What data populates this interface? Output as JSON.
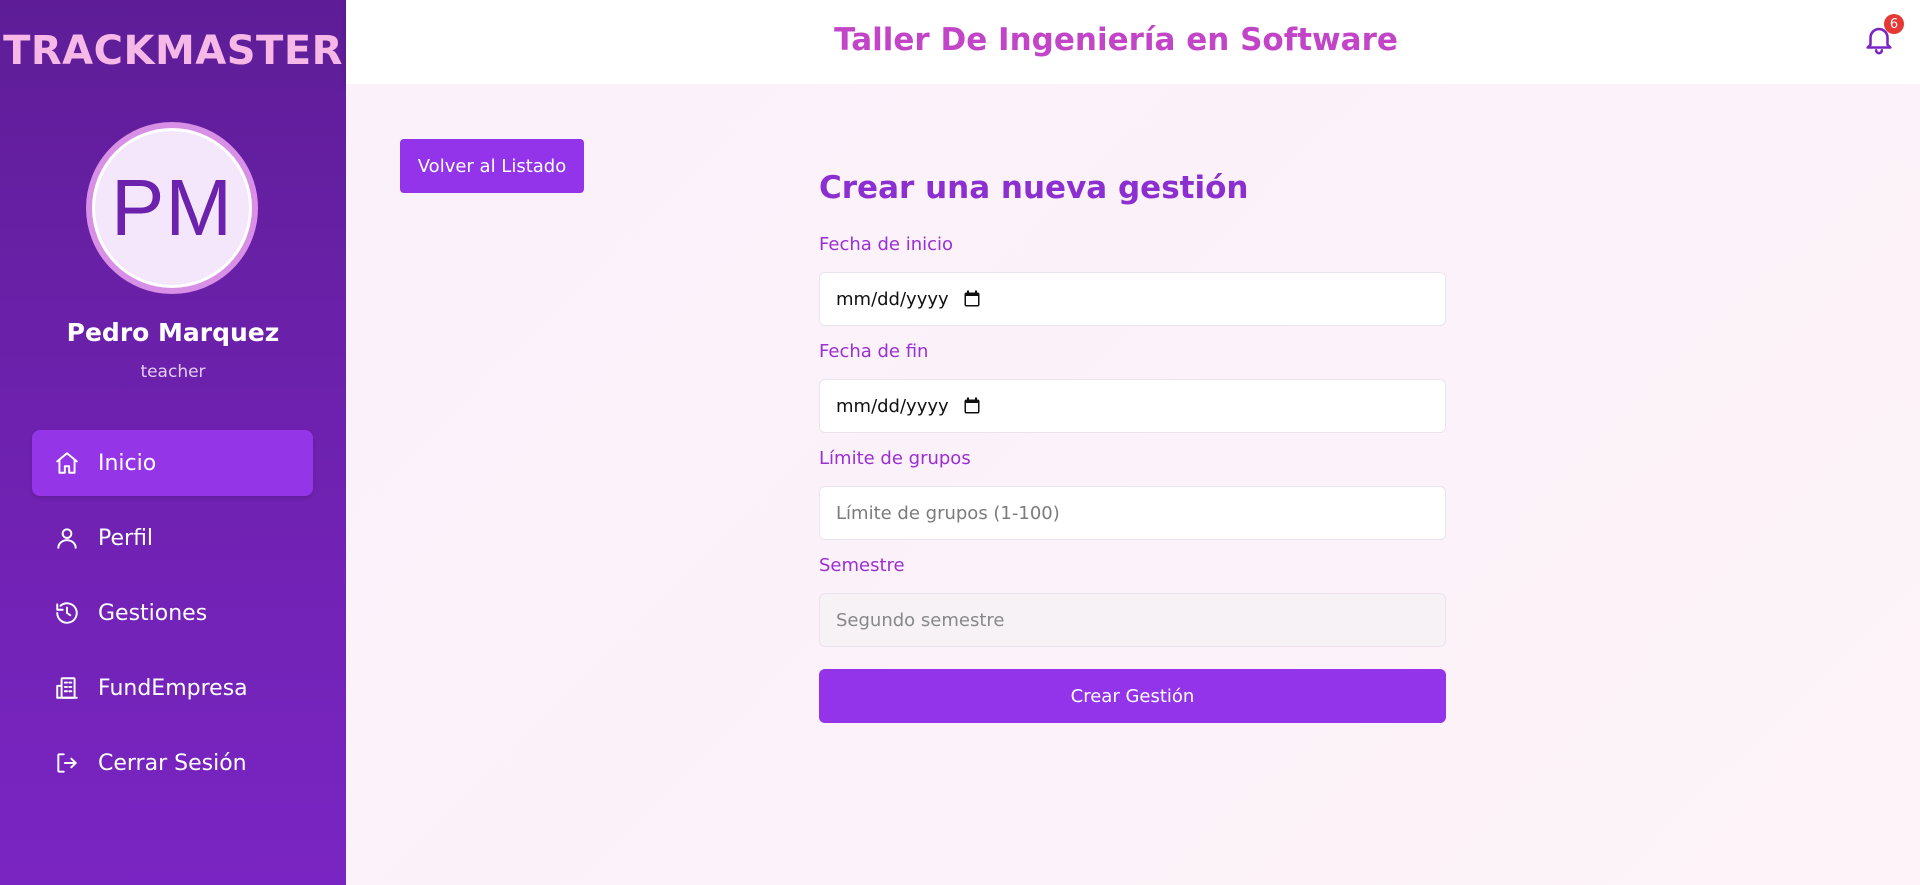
{
  "sidebar": {
    "brand": "TRACKMASTER",
    "avatar_initials": "PM",
    "user_name": "Pedro Marquez",
    "user_role": "teacher",
    "items": [
      {
        "label": "Inicio",
        "icon": "home-icon",
        "active": true
      },
      {
        "label": "Perfil",
        "icon": "user-icon",
        "active": false
      },
      {
        "label": "Gestiones",
        "icon": "history-icon",
        "active": false
      },
      {
        "label": "FundEmpresa",
        "icon": "building-icon",
        "active": false
      },
      {
        "label": "Cerrar Sesión",
        "icon": "logout-icon",
        "active": false
      }
    ]
  },
  "header": {
    "title": "Taller De Ingeniería en Software",
    "notification_count": "6"
  },
  "main": {
    "back_button": "Volver al Listado",
    "form": {
      "title": "Crear una nueva gestión",
      "start_label": "Fecha de inicio",
      "start_value": "mm/dd/yyyy",
      "end_label": "Fecha de fin",
      "end_value": "mm/dd/yyyy",
      "groups_label": "Límite de grupos",
      "groups_placeholder": "Límite de grupos (1-100)",
      "semester_label": "Semestre",
      "semester_value": "Segundo semestre",
      "submit_label": "Crear Gestión"
    }
  },
  "colors": {
    "sidebar_top": "#5e1d97",
    "sidebar_bottom": "#7a25c3",
    "accent": "#9333ea",
    "header_title": "#c245c8",
    "brand": "#f6b8e6",
    "badge": "#e53935"
  }
}
